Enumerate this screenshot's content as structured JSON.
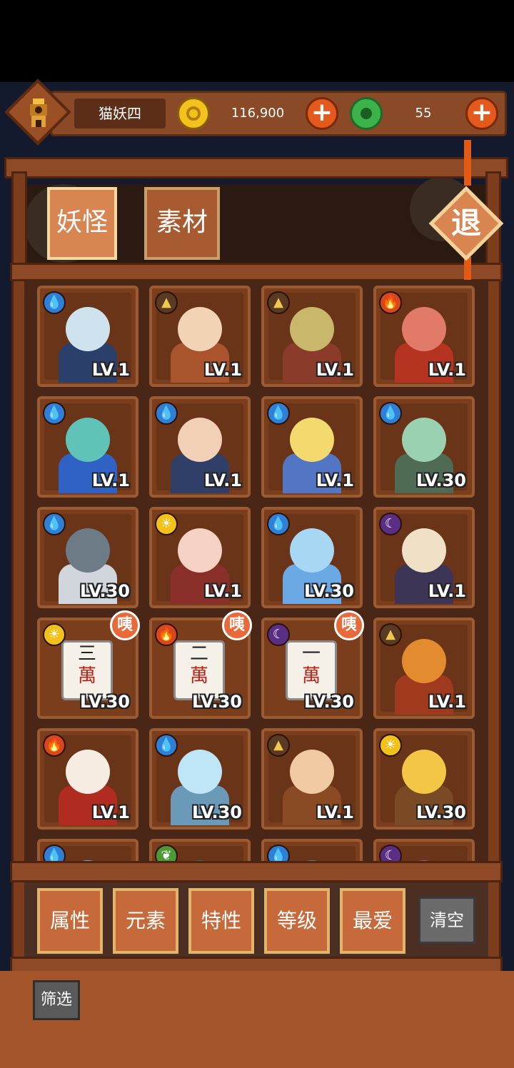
{
  "player": {
    "name": "猫妖四",
    "coins": "116,900",
    "jade": "55"
  },
  "icons": {
    "coin": "gold-coin-icon",
    "jade": "jade-coin-icon",
    "plus": "plus-icon"
  },
  "tabs": [
    {
      "label": "妖怪",
      "active": true
    },
    {
      "label": "素材",
      "active": false
    }
  ],
  "exit_label": "退",
  "colors": {
    "accent": "#d98552",
    "frame": "#8e4a26",
    "water": "#2f7fd6",
    "fire": "#d9481d",
    "light": "#f3c21a",
    "dark": "#5b2e86",
    "earth": "#5a3a22",
    "wood": "#4b9a34"
  },
  "grid": [
    {
      "level": "LV.1",
      "element": "water",
      "art": [
        "#cfe3ef",
        "#2b3f6b"
      ]
    },
    {
      "level": "LV.1",
      "element": "earth",
      "art": [
        "#f3d3b6",
        "#a9542d"
      ]
    },
    {
      "level": "LV.1",
      "element": "earth",
      "art": [
        "#c9b76c",
        "#8a3b2a"
      ]
    },
    {
      "level": "LV.1",
      "element": "fire",
      "art": [
        "#e27a6a",
        "#b53321"
      ]
    },
    {
      "level": "LV.1",
      "element": "water",
      "art": [
        "#5fc3b7",
        "#2f62c4"
      ]
    },
    {
      "level": "LV.1",
      "element": "water",
      "art": [
        "#f2d0b6",
        "#2f3f68"
      ]
    },
    {
      "level": "LV.1",
      "element": "water",
      "art": [
        "#f4d96e",
        "#5276c4"
      ]
    },
    {
      "level": "LV.30",
      "element": "water",
      "art": [
        "#9ad1b1",
        "#4f6b54"
      ]
    },
    {
      "level": "LV.30",
      "element": "water",
      "art": [
        "#6c7b86",
        "#d0d6dc"
      ]
    },
    {
      "level": "LV.1",
      "element": "light",
      "art": [
        "#f5d2c3",
        "#8a2f2a"
      ]
    },
    {
      "level": "LV.30",
      "element": "water",
      "art": [
        "#a8d7f3",
        "#6aa9e3"
      ]
    },
    {
      "level": "LV.1",
      "element": "dark",
      "art": [
        "#f0e0c6",
        "#3d3556"
      ]
    },
    {
      "level": "LV.30",
      "element": "light",
      "tile": {
        "num": "三",
        "word": "萬"
      },
      "badge": "咦"
    },
    {
      "level": "LV.30",
      "element": "fire",
      "tile": {
        "num": "二",
        "word": "萬"
      },
      "badge": "咦"
    },
    {
      "level": "LV.30",
      "element": "dark",
      "tile": {
        "num": "一",
        "word": "萬"
      },
      "badge": "咦"
    },
    {
      "level": "LV.1",
      "element": "earth",
      "art": [
        "#e38b2f",
        "#9f3a1f"
      ]
    },
    {
      "level": "LV.1",
      "element": "fire",
      "art": [
        "#f7ece1",
        "#b02b20"
      ]
    },
    {
      "level": "LV.30",
      "element": "water",
      "art": [
        "#bfe6f7",
        "#6a9ab8"
      ]
    },
    {
      "level": "LV.1",
      "element": "earth",
      "art": [
        "#f1c9a3",
        "#8a4a24"
      ]
    },
    {
      "level": "LV.30",
      "element": "light",
      "art": [
        "#f3c745",
        "#7a4a24"
      ]
    },
    {
      "level": "",
      "element": "water",
      "art": [
        "#7aa8d6",
        "#5b6b7a"
      ]
    },
    {
      "level": "",
      "element": "wood",
      "art": [
        "#3b6a5a",
        "#2a4a3a"
      ]
    },
    {
      "level": "",
      "element": "water",
      "art": [
        "#4b7a8a",
        "#3a5a6a"
      ]
    },
    {
      "level": "",
      "element": "dark",
      "art": [
        "#8a5a9a",
        "#5a3a6a"
      ]
    }
  ],
  "filters": [
    "属性",
    "元素",
    "特性",
    "等级",
    "最爱"
  ],
  "clear_label": "清空",
  "screen_label": "筛选"
}
